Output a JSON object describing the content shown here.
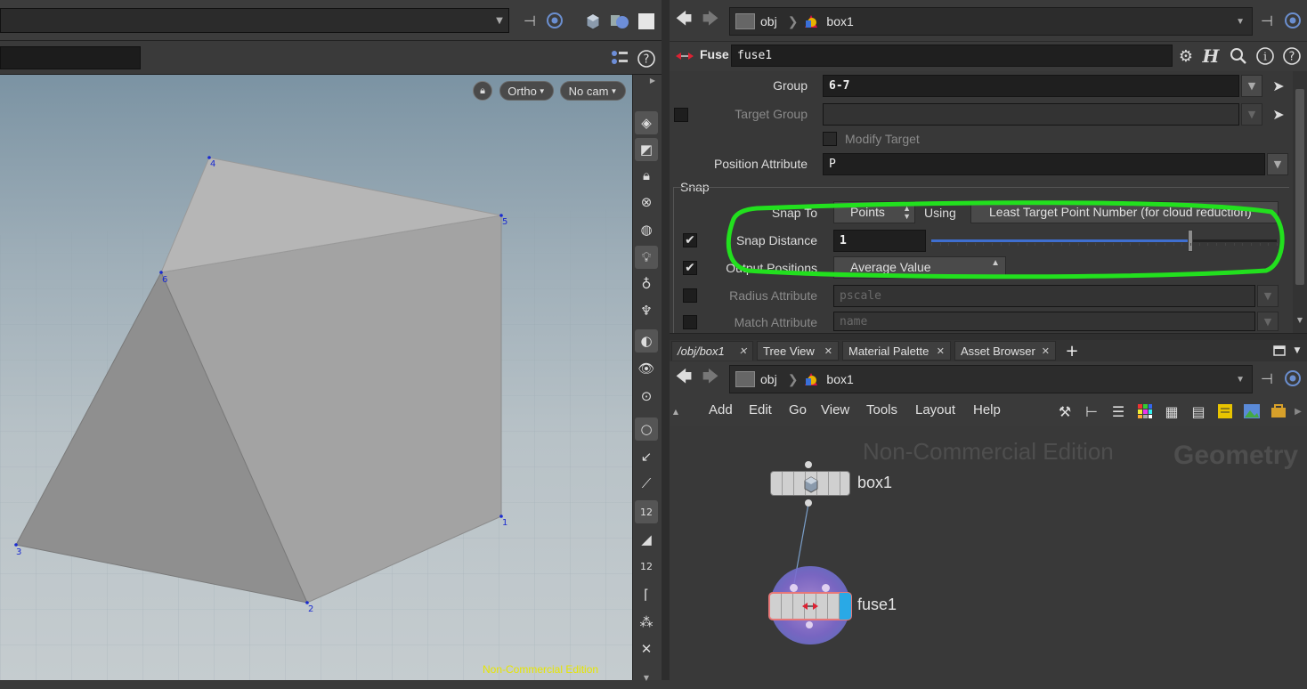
{
  "viewport": {
    "view_mode": "Ortho",
    "camera": "No cam",
    "watermark": "Non-Commercial Edition",
    "points": [
      "1",
      "2",
      "3",
      "4",
      "5",
      "6"
    ]
  },
  "path_bar": {
    "context": "obj",
    "node": "box1"
  },
  "parm_header": {
    "node_type": "Fuse",
    "node_name": "fuse1"
  },
  "parms": {
    "group_label": "Group",
    "group_value": "6-7",
    "target_group_label": "Target Group",
    "modify_target_label": "Modify Target",
    "position_attr_label": "Position Attribute",
    "position_attr_value": "P",
    "snap_section": "Snap",
    "snap_to_label": "Snap To",
    "snap_to_value": "Points",
    "using_label": "Using",
    "using_value": "Least Target Point Number (for cloud reduction)",
    "snap_distance_label": "Snap Distance",
    "snap_distance_value": "1",
    "snap_distance_fraction": 0.75,
    "output_positions_label": "Output Positions",
    "output_positions_value": "Average Value",
    "radius_attr_label": "Radius Attribute",
    "radius_attr_value": "pscale",
    "match_attr_label": "Match Attribute",
    "match_attr_value": "name"
  },
  "tabs": [
    {
      "label": "/obj/box1"
    },
    {
      "label": "Tree View"
    },
    {
      "label": "Material Palette"
    },
    {
      "label": "Asset Browser"
    }
  ],
  "net_path": {
    "context": "obj",
    "node": "box1"
  },
  "menu": [
    "Add",
    "Edit",
    "Go",
    "View",
    "Tools",
    "Layout",
    "Help"
  ],
  "network": {
    "watermark": "Non-Commercial Edition",
    "context_label": "Geometry",
    "nodes": [
      {
        "name": "box1"
      },
      {
        "name": "fuse1"
      }
    ]
  },
  "colors": {
    "highlight": "#22e01e",
    "display_flag": "#29a9e6",
    "selection_halo": "#8a6fd0"
  }
}
